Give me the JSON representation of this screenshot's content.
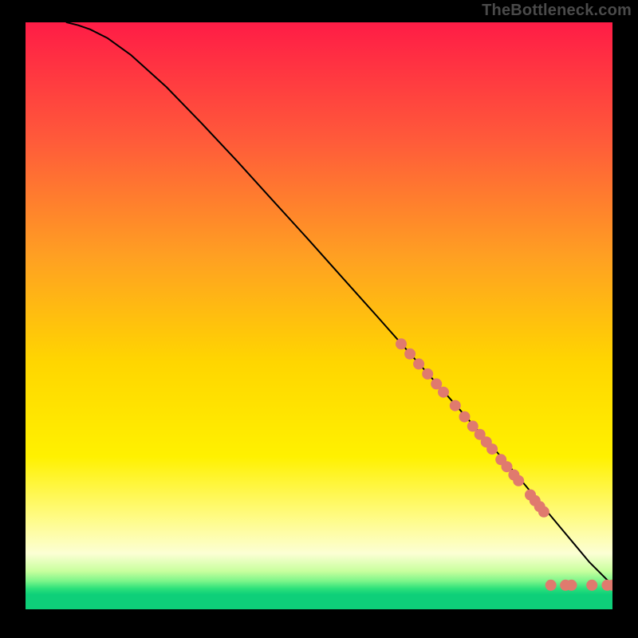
{
  "watermark": "TheBottleneck.com",
  "chart_data": {
    "type": "line",
    "title": "",
    "xlabel": "",
    "ylabel": "",
    "xlim": [
      0,
      100
    ],
    "ylim": [
      0,
      100
    ],
    "grid": false,
    "legend": false,
    "background_gradient": {
      "stops": [
        {
          "offset": 0.0,
          "color": "#ff1c46"
        },
        {
          "offset": 0.2,
          "color": "#ff5a3a"
        },
        {
          "offset": 0.4,
          "color": "#ffa022"
        },
        {
          "offset": 0.58,
          "color": "#ffd600"
        },
        {
          "offset": 0.74,
          "color": "#fff100"
        },
        {
          "offset": 0.84,
          "color": "#fffb80"
        },
        {
          "offset": 0.905,
          "color": "#fcffd4"
        },
        {
          "offset": 0.935,
          "color": "#c8ff9e"
        },
        {
          "offset": 0.952,
          "color": "#7cf58a"
        },
        {
          "offset": 0.965,
          "color": "#2be07a"
        },
        {
          "offset": 0.975,
          "color": "#0ecf79"
        },
        {
          "offset": 1.0,
          "color": "#0ecf79"
        }
      ]
    },
    "series": [
      {
        "name": "main-curve",
        "x": [
          7,
          9,
          11,
          14,
          18,
          24,
          30,
          36,
          42,
          48,
          54,
          60,
          66,
          70,
          74,
          78,
          81,
          83.5,
          85.5,
          87.5,
          89.5,
          91.5,
          93.5,
          96,
          98.5,
          100
        ],
        "y": [
          100,
          99.5,
          98.8,
          97.3,
          94.4,
          89.0,
          82.8,
          76.4,
          69.8,
          63.2,
          56.5,
          49.8,
          43.0,
          38.5,
          34.0,
          29.4,
          26.0,
          23.1,
          20.7,
          18.3,
          15.9,
          13.5,
          11.1,
          8.1,
          5.6,
          4.1
        ]
      }
    ],
    "markers": {
      "name": "highlight-dots",
      "color": "#e07a6e",
      "radius_px": 7,
      "points": [
        {
          "x": 64.0,
          "y": 45.2
        },
        {
          "x": 65.5,
          "y": 43.5
        },
        {
          "x": 67.0,
          "y": 41.8
        },
        {
          "x": 68.5,
          "y": 40.1
        },
        {
          "x": 70.0,
          "y": 38.4
        },
        {
          "x": 71.2,
          "y": 37.0
        },
        {
          "x": 73.2,
          "y": 34.7
        },
        {
          "x": 74.8,
          "y": 32.8
        },
        {
          "x": 76.2,
          "y": 31.2
        },
        {
          "x": 77.4,
          "y": 29.8
        },
        {
          "x": 78.5,
          "y": 28.5
        },
        {
          "x": 79.5,
          "y": 27.3
        },
        {
          "x": 81.0,
          "y": 25.5
        },
        {
          "x": 82.0,
          "y": 24.3
        },
        {
          "x": 83.2,
          "y": 22.9
        },
        {
          "x": 84.0,
          "y": 21.9
        },
        {
          "x": 86.0,
          "y": 19.5
        },
        {
          "x": 86.8,
          "y": 18.5
        },
        {
          "x": 87.6,
          "y": 17.5
        },
        {
          "x": 88.3,
          "y": 16.6
        },
        {
          "x": 89.5,
          "y": 4.1
        },
        {
          "x": 92.0,
          "y": 4.1
        },
        {
          "x": 93.0,
          "y": 4.1
        },
        {
          "x": 96.5,
          "y": 4.1
        },
        {
          "x": 99.1,
          "y": 4.1
        },
        {
          "x": 100.0,
          "y": 4.1
        }
      ]
    }
  }
}
